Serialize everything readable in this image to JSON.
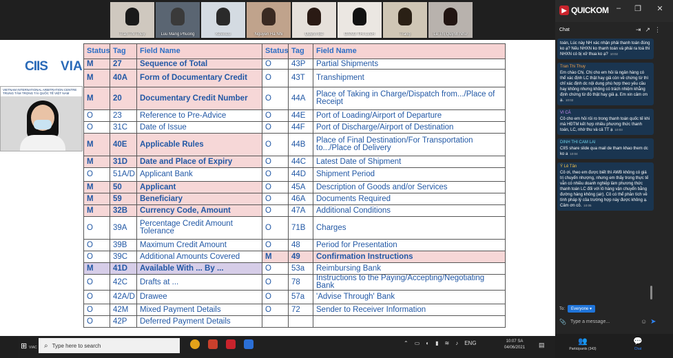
{
  "gallery": {
    "participants": [
      {
        "name": "Tran Thi Thuy",
        "bg": "#cfc8bf",
        "skin": "#1a1a1a"
      },
      {
        "name": "Luu Mang Phuong",
        "bg": "#5a6572",
        "skin": "#3a3a3a"
      },
      {
        "name": "KevinLu",
        "bg": "#d4dbe2",
        "skin": "#2a2a2a"
      },
      {
        "name": "Nguyễn Hà Nhi",
        "bg": "#c0a38c",
        "skin": "#3a2a22"
      },
      {
        "name": "Quỳnh Bé",
        "bg": "#e6e0da",
        "skin": "#2a1a14"
      },
      {
        "name": "DANG THI LINH",
        "bg": "#ebe7e2",
        "skin": "#121212"
      },
      {
        "name": "Trang",
        "bg": "#cfc6b5",
        "skin": "#2a2015"
      },
      {
        "name": "Lê Thị Quỳnh Như",
        "bg": "#b8b2ad",
        "skin": "#221512"
      }
    ]
  },
  "slide": {
    "logo_ciis": "CIIS",
    "logo_via": "VIA",
    "speaker_banner_1": "VIETNAM INTERNATIONAL ARBITRATION CENTRE",
    "speaker_banner_2": "TRUNG TÂM TRỌNG TÀI QUỐC TẾ VIỆT NAM",
    "header": {
      "status": "Status",
      "tag": "Tag",
      "field": "Field Name"
    },
    "rows": [
      {
        "s1": "M",
        "t1": "27",
        "f1": "Sequence of Total",
        "s2": "O",
        "t2": "43P",
        "f2": "Partial Shipments",
        "bg1": "pink",
        "bg2": "",
        "h": 15
      },
      {
        "s1": "M",
        "t1": "40A",
        "f1": "Form of Documentary Credit",
        "s2": "O",
        "t2": "43T",
        "f2": "Transhipment",
        "bg1": "pink",
        "bg2": "",
        "h": 26
      },
      {
        "s1": "M",
        "t1": "20",
        "f1": "Documentary Credit Number",
        "s2": "O",
        "t2": "44A",
        "f2": "Place of Taking in Charge/Dispatch from.../Place of Receipt",
        "bg1": "pink",
        "bg2": "",
        "h": 33
      },
      {
        "s1": "O",
        "t1": "23",
        "f1": "Reference to Pre-Advice",
        "s2": "O",
        "t2": "44E",
        "f2": "Port of Loading/Airport of Departure",
        "bg1": "",
        "bg2": "",
        "h": 17
      },
      {
        "s1": "O",
        "t1": "31C",
        "f1": "Date of Issue",
        "s2": "O",
        "t2": "44F",
        "f2": "Port of Discharge/Airport of Destination",
        "bg1": "",
        "bg2": "",
        "h": 17
      },
      {
        "s1": "M",
        "t1": "40E",
        "f1": "Applicable Rules",
        "s2": "O",
        "t2": "44B",
        "f2": "Place of Final Destination/For Transportation to.../Place of Delivery",
        "bg1": "pink",
        "bg2": "",
        "h": 33
      },
      {
        "s1": "M",
        "t1": "31D",
        "f1": "Date and Place of Expiry",
        "s2": "O",
        "t2": "44C",
        "f2": "Latest Date of Shipment",
        "bg1": "pink",
        "bg2": "",
        "h": 17
      },
      {
        "s1": "O",
        "t1": "51A/D",
        "f1": "Applicant Bank",
        "s2": "O",
        "t2": "44D",
        "f2": "Shipment Period",
        "bg1": "",
        "bg2": "",
        "h": 20
      },
      {
        "s1": "M",
        "t1": "50",
        "f1": "Applicant",
        "s2": "O",
        "t2": "45A",
        "f2": "Description of Goods and/or Services",
        "bg1": "pink",
        "bg2": "",
        "h": 17
      },
      {
        "s1": "M",
        "t1": "59",
        "f1": "Beneficiary",
        "s2": "O",
        "t2": "46A",
        "f2": "Documents Required",
        "bg1": "pink",
        "bg2": "",
        "h": 17
      },
      {
        "s1": "M",
        "t1": "32B",
        "f1": "Currency Code, Amount",
        "s2": "O",
        "t2": "47A",
        "f2": "Additional Conditions",
        "bg1": "pink",
        "bg2": "",
        "h": 17
      },
      {
        "s1": "O",
        "t1": "39A",
        "f1": "Percentage Credit Amount Tolerance",
        "s2": "O",
        "t2": "71B",
        "f2": "Charges",
        "bg1": "",
        "bg2": "",
        "h": 33
      },
      {
        "s1": "O",
        "t1": "39B",
        "f1": "Maximum Credit Amount",
        "s2": "O",
        "t2": "48",
        "f2": "Period for Presentation",
        "bg1": "",
        "bg2": "",
        "h": 17
      },
      {
        "s1": "O",
        "t1": "39C",
        "f1": "Additional Amounts Covered",
        "s2": "M",
        "t2": "49",
        "f2": "Confirmation Instructions",
        "bg1": "",
        "bg2": "pink",
        "h": 17
      },
      {
        "s1": "M",
        "t1": "41D",
        "f1": "Available With ... By ...",
        "s2": "O",
        "t2": "53a",
        "f2": "Reimbursing Bank",
        "bg1": "purple",
        "bg2": "",
        "h": 17
      },
      {
        "s1": "O",
        "t1": "42C",
        "f1": "Drafts at ...",
        "s2": "O",
        "t2": "78",
        "f2": "Instructions to the Paying/Accepting/Negotiating Bank",
        "bg1": "",
        "bg2": "",
        "h": 22
      },
      {
        "s1": "O",
        "t1": "42A/D",
        "f1": "Drawee",
        "s2": "O",
        "t2": "57a",
        "f2": "'Advise Through' Bank",
        "bg1": "",
        "bg2": "",
        "h": 20
      },
      {
        "s1": "O",
        "t1": "42M",
        "f1": "Mixed Payment Details",
        "s2": "O",
        "t2": "72",
        "f2": "Sender to Receiver Information",
        "bg1": "",
        "bg2": "",
        "h": 17
      },
      {
        "s1": "O",
        "t1": "42P",
        "f1": "Deferred Payment Details",
        "s2": "",
        "t2": "",
        "f2": "",
        "bg1": "",
        "bg2": "",
        "h": 17
      }
    ]
  },
  "chat": {
    "app_logo": "QUICKOM",
    "title": "Chat",
    "messages": [
      {
        "who": "",
        "color": "#fff",
        "text": "toán, Lúc này NH xác nhận phải thanh toán đúng ko ạ? Nếu NHXN ko thanh toán và phải ra toà thì NHXN có bị xử thua ko ạ?",
        "time": "10:02"
      },
      {
        "who": "Tran Thi Thuy",
        "color": "#f0a04b",
        "text": "Em chào Chị. Chị cho em hỏi là ngân hàng có thể xác định LC thật hay giả còn về chứng từ thì chỉ xác định dc nội dung phù hợp theo yêu cầu hay không nhưng không có trách nhiệm khẳng định chứng từ đó thật hay giả ạ. Em xin cảm ơn ạ.",
        "time": "10:02"
      },
      {
        "who": "VI CÁ",
        "color": "#c78bf0",
        "text": "Cô cho em hỏi rủi ro trong thanh toán quốc tế khi mà HĐTM kết hợp nhiều phương thức thanh toán, LC, nhờ thu và cả TT ạ",
        "time": "10:03"
      },
      {
        "who": "DINH THI CAM LAI",
        "color": "#6fd3e8",
        "text": "CIIS share slide qua mail de tham khao them dc ko a",
        "time": "10:04"
      },
      {
        "who": "Ý Lê Tân",
        "color": "#f0c04b",
        "text": "Cô ơi, theo em được biết thì AWB không có giá trị chuyển nhượng, nhưng em thấy trong thực tế vẫn có nhiều doanh nghiệp làm phương thức thanh toán LC đối với lô hàng vận chuyển bằng đường hàng không (air). Cô có thể phân tích về tính pháp lý của trường hợp này được không ạ. Cảm ơn cô.",
        "time": "10:05"
      }
    ],
    "to_label": "To:",
    "to_value": "Everyone",
    "input_placeholder": "Type a message...",
    "tab_participants": "Participants (343)",
    "tab_chat": "Chat"
  },
  "taskbar": {
    "start_label": "VIAC",
    "search_placeholder": "Type here to search",
    "lang": "ENG",
    "time": "10:07 SA",
    "date": "04/06/2021"
  }
}
